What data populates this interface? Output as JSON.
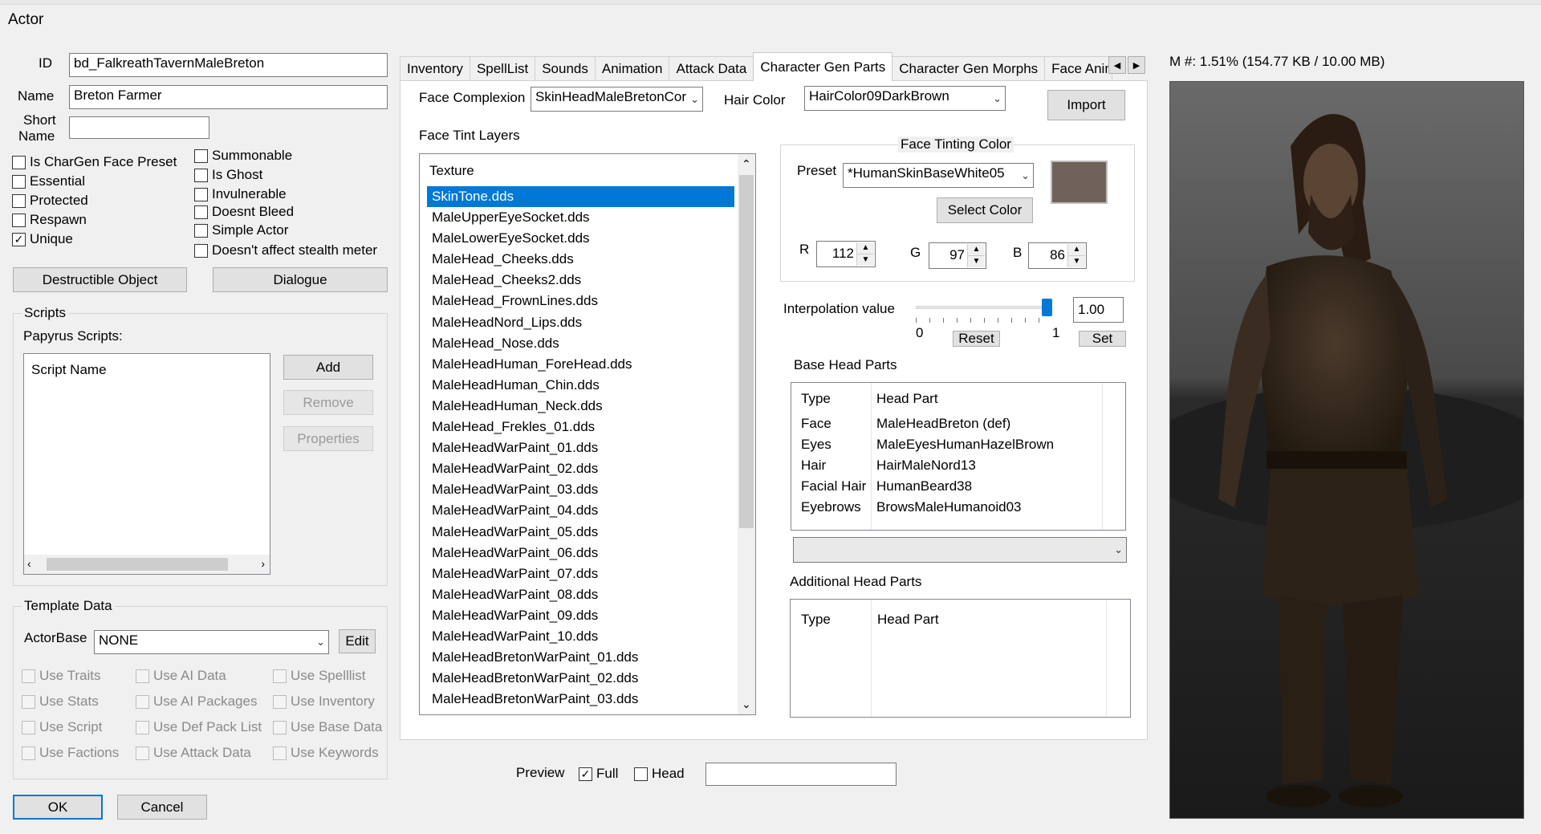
{
  "window": {
    "title": "Actor"
  },
  "memory": "M #: 1.51% (154.77 KB / 10.00 MB)",
  "left": {
    "id_label": "ID",
    "id_value": "bd_FalkreathTavernMaleBreton",
    "name_label": "Name",
    "name_value": "Breton Farmer",
    "short_label_1": "Short",
    "short_label_2": "Name",
    "short_value": "",
    "flags_col1": [
      {
        "label": "Is CharGen Face Preset",
        "checked": false
      },
      {
        "label": "Essential",
        "checked": false
      },
      {
        "label": "Protected",
        "checked": false
      },
      {
        "label": "Respawn",
        "checked": false
      },
      {
        "label": "Unique",
        "checked": true
      }
    ],
    "flags_col2": [
      {
        "label": "Summonable",
        "checked": false
      },
      {
        "label": "Is Ghost",
        "checked": false
      },
      {
        "label": "Invulnerable",
        "checked": false
      },
      {
        "label": "Doesnt Bleed",
        "checked": false
      },
      {
        "label": "Simple Actor",
        "checked": false
      },
      {
        "label": "Doesn't affect stealth meter",
        "checked": false
      }
    ],
    "destructible_button": "Destructible Object",
    "dialogue_button": "Dialogue",
    "scripts": {
      "group_title": "Scripts",
      "papyrus_label": "Papyrus Scripts:",
      "column_header": "Script Name",
      "add": "Add",
      "remove": "Remove",
      "properties": "Properties"
    },
    "template": {
      "group_title": "Template Data",
      "actorbase_label": "ActorBase",
      "actorbase_value": "NONE",
      "edit": "Edit",
      "uses": [
        [
          "Use Traits",
          "Use AI Data",
          "Use Spelllist"
        ],
        [
          "Use Stats",
          "Use AI Packages",
          "Use Inventory"
        ],
        [
          "Use Script",
          "Use Def Pack List",
          "Use Base Data"
        ],
        [
          "Use Factions",
          "Use Attack Data",
          "Use Keywords"
        ]
      ]
    },
    "ok": "OK",
    "cancel": "Cancel"
  },
  "tabs": [
    "Inventory",
    "SpellList",
    "Sounds",
    "Animation",
    "Attack Data",
    "Character Gen Parts",
    "Character Gen Morphs",
    "Face Anim F"
  ],
  "active_tab": "Character Gen Parts",
  "chargen": {
    "face_complexion_label": "Face Complexion",
    "face_complexion_value": "SkinHeadMaleBretonCor",
    "hair_color_label": "Hair Color",
    "hair_color_value": "HairColor09DarkBrown",
    "import": "Import",
    "tint_layers_label": "Face Tint Layers",
    "texture_header": "Texture",
    "textures": [
      "SkinTone.dds",
      "MaleUpperEyeSocket.dds",
      "MaleLowerEyeSocket.dds",
      "MaleHead_Cheeks.dds",
      "MaleHead_Cheeks2.dds",
      "MaleHead_FrownLines.dds",
      "MaleHeadNord_Lips.dds",
      "MaleHead_Nose.dds",
      "MaleHeadHuman_ForeHead.dds",
      "MaleHeadHuman_Chin.dds",
      "MaleHeadHuman_Neck.dds",
      "MaleHead_Frekles_01.dds",
      "MaleHeadWarPaint_01.dds",
      "MaleHeadWarPaint_02.dds",
      "MaleHeadWarPaint_03.dds",
      "MaleHeadWarPaint_04.dds",
      "MaleHeadWarPaint_05.dds",
      "MaleHeadWarPaint_06.dds",
      "MaleHeadWarPaint_07.dds",
      "MaleHeadWarPaint_08.dds",
      "MaleHeadWarPaint_09.dds",
      "MaleHeadWarPaint_10.dds",
      "MaleHeadBretonWarPaint_01.dds",
      "MaleHeadBretonWarPaint_02.dds",
      "MaleHeadBretonWarPaint_03.dds"
    ],
    "selected_texture": "SkinTone.dds",
    "tint": {
      "group_title": "Face Tinting Color",
      "preset_label": "Preset",
      "preset_value": "*HumanSkinBaseWhite05",
      "swatch_color": "#70615a",
      "select_color": "Select Color",
      "r_label": "R",
      "r_value": "112",
      "g_label": "G",
      "g_value": "97",
      "b_label": "B",
      "b_value": "86"
    },
    "interp": {
      "label": "Interpolation value",
      "value": "1.00",
      "level": 1.0,
      "min": "0",
      "max": "1",
      "reset": "Reset",
      "set": "Set"
    },
    "base_head_parts": {
      "label": "Base Head Parts",
      "col_type": "Type",
      "col_part": "Head Part",
      "rows": [
        {
          "type": "Face",
          "part": "MaleHeadBreton (def)"
        },
        {
          "type": "Eyes",
          "part": "MaleEyesHumanHazelBrown"
        },
        {
          "type": "Hair",
          "part": "HairMaleNord13"
        },
        {
          "type": "Facial Hair",
          "part": "HumanBeard38"
        },
        {
          "type": "Eyebrows",
          "part": "BrowsMaleHumanoid03"
        }
      ]
    },
    "additional_head_parts": {
      "label": "Additional Head Parts",
      "col_type": "Type",
      "col_part": "Head Part"
    }
  },
  "preview": {
    "label": "Preview",
    "full_label": "Full",
    "full_checked": true,
    "head_label": "Head",
    "head_checked": false,
    "field_value": ""
  }
}
